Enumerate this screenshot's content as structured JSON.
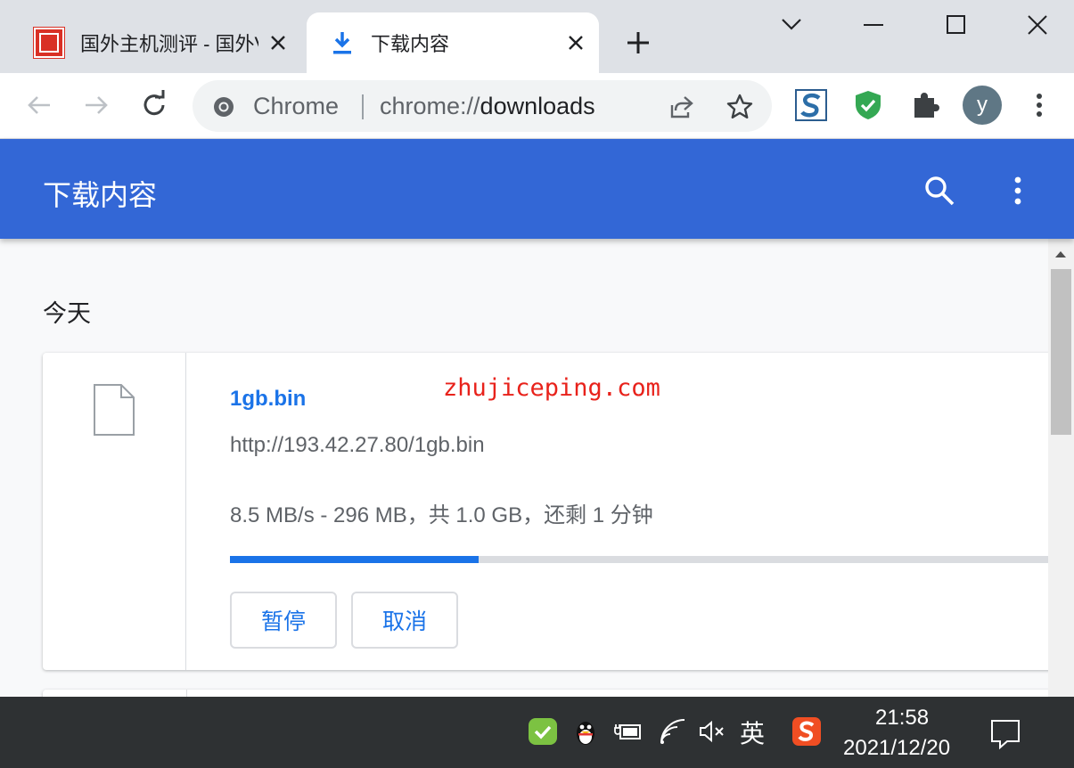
{
  "tabs": [
    {
      "title": "国外主机测评 - 国外VPS",
      "active": false
    },
    {
      "title": "下载内容",
      "active": true
    }
  ],
  "omnibox": {
    "site_label": "Chrome",
    "url_scheme": "chrome://",
    "url_host": "downloads"
  },
  "profile": {
    "initial": "y"
  },
  "downloads_page": {
    "header_title": "下载内容",
    "section_date": "今天",
    "items": [
      {
        "file_name": "1gb.bin",
        "url": "http://193.42.27.80/1gb.bin",
        "status": "8.5 MB/s - 296 MB，共 1.0 GB，还剩 1 分钟",
        "progress_fraction": 0.3,
        "pause_label": "暂停",
        "cancel_label": "取消"
      }
    ]
  },
  "watermark": "zhujiceping.com",
  "taskbar": {
    "ime_label": "英",
    "time": "21:58",
    "date": "2021/12/20"
  },
  "colors": {
    "header_blue": "#3367d6",
    "accent_blue": "#1a73e8",
    "watermark_red": "#e8221b",
    "taskbar": "#2e3133"
  }
}
